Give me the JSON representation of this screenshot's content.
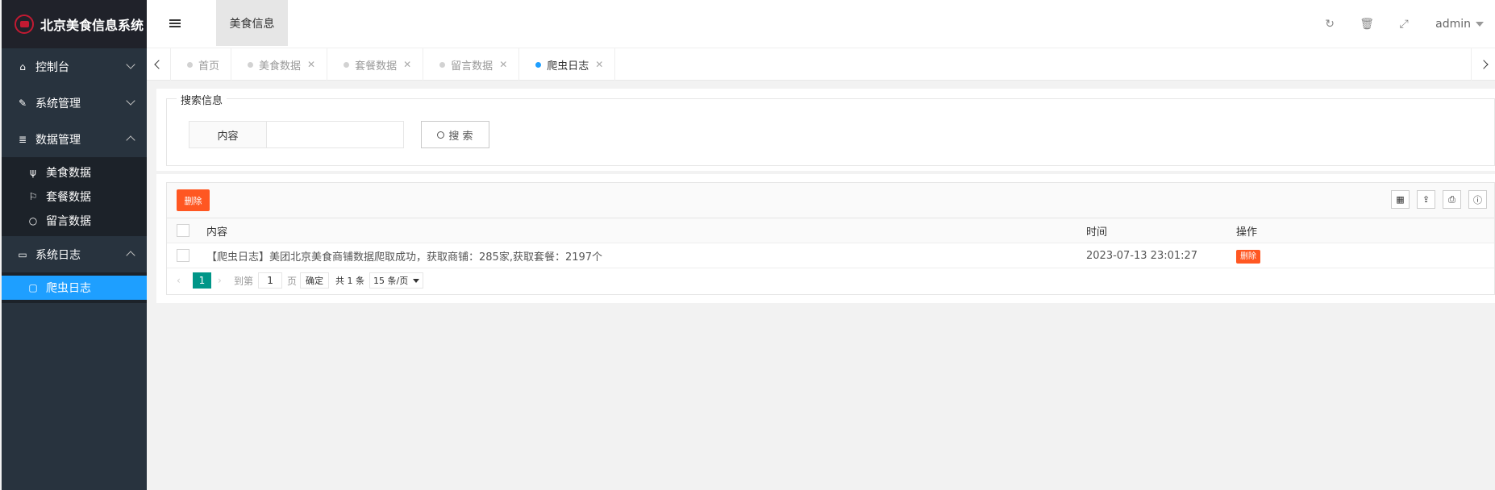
{
  "app": {
    "title": "北京美食信息系统"
  },
  "sidebar": {
    "items": [
      {
        "label": "控制台",
        "icon": "home-icon"
      },
      {
        "label": "系统管理",
        "icon": "wrench-icon"
      },
      {
        "label": "数据管理",
        "icon": "database-icon"
      }
    ],
    "data_sub": [
      {
        "label": "美食数据",
        "icon": "cutlery-icon"
      },
      {
        "label": "套餐数据",
        "icon": "flag-icon"
      },
      {
        "label": "留言数据",
        "icon": "comment-icon"
      }
    ],
    "log": {
      "label": "系统日志",
      "icon": "laptop-icon"
    },
    "log_sub": [
      {
        "label": "爬虫日志",
        "icon": "folder-icon"
      }
    ]
  },
  "header": {
    "tab": "美食信息",
    "user": "admin"
  },
  "tabs": [
    {
      "label": "首页"
    },
    {
      "label": "美食数据"
    },
    {
      "label": "套餐数据"
    },
    {
      "label": "留言数据"
    },
    {
      "label": "爬虫日志"
    }
  ],
  "search": {
    "legend": "搜索信息",
    "field_label": "内容",
    "value": "",
    "button": "搜 索"
  },
  "table": {
    "delete_label": "删除",
    "columns": {
      "content": "内容",
      "time": "时间",
      "op": "操作"
    },
    "rows": [
      {
        "content": "【爬虫日志】美团北京美食商铺数据爬取成功，获取商铺：285家,获取套餐：2197个",
        "time": "2023-07-13 23:01:27",
        "op": "删除"
      }
    ]
  },
  "pager": {
    "current": "1",
    "goto_label": "到第",
    "goto_value": "1",
    "page_unit": "页",
    "confirm": "确定",
    "total": "共 1 条",
    "size": "15 条/页"
  },
  "colors": {
    "accent": "#1e9fff",
    "danger": "#ff5722",
    "pager": "#009688",
    "sidebar": "#28333e"
  }
}
